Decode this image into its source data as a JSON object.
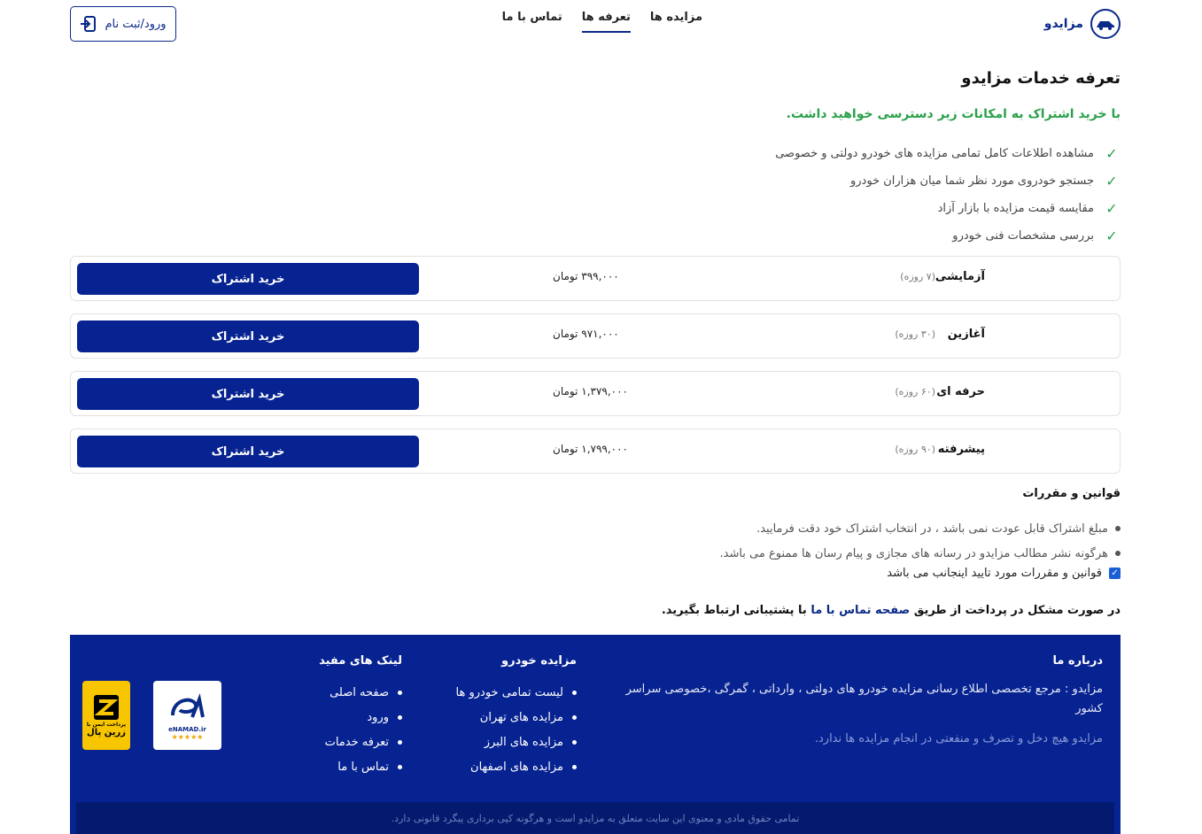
{
  "header": {
    "brand": "مزایدو",
    "nav": [
      "مزایده ها",
      "تعرفه ها",
      "تماس با ما"
    ],
    "login_label": "ورود/ثبت نام"
  },
  "page": {
    "title": "تعرفه خدمات مزایدو",
    "subtitle": "با خرید اشتراک به امکانات زیر دسترسی خواهید داشت.",
    "features": [
      "مشاهده اطلاعات کامل تمامی مزایده های خودرو دولتی و خصوصی",
      "جستجو خودروی مورد نظر شما میان هزاران خودرو",
      "مقایسه قیمت مزایده با بازار آزاد",
      "بررسی مشخصات فنی خودرو"
    ]
  },
  "plans": [
    {
      "name": "آزمایشی",
      "duration": "(۷ روزه)",
      "price": "۳۹۹,۰۰۰ تومان",
      "button": "خرید اشتراک"
    },
    {
      "name": "آغازین",
      "duration": "(۳۰ روزه)",
      "price": "۹۷۱,۰۰۰ تومان",
      "button": "خرید اشتراک"
    },
    {
      "name": "حرفه ای",
      "duration": "(۶۰ روزه)",
      "price": "۱,۳۷۹,۰۰۰ تومان",
      "button": "خرید اشتراک"
    },
    {
      "name": "پیشرفته",
      "duration": "(۹۰ روزه)",
      "price": "۱,۷۹۹,۰۰۰ تومان",
      "button": "خرید اشتراک"
    }
  ],
  "rules": {
    "title": "قوانین و مقررات",
    "items": [
      "مبلغ اشتراک قابل عودت نمی باشد ، در انتخاب اشتراک خود دقت فرمایید.",
      "هرگونه نشر مطالب مزایدو در رسانه های مجازی و پیام رسان ها ممنوع می باشد."
    ],
    "accept_label": "قوانین و مقررات مورد تایید اینجانب می باشد",
    "accepted": true
  },
  "support": {
    "before": "در صورت مشکل در پرداخت از طریق",
    "link": "صفحه تماس با ما",
    "after": "با پشتیبانی ارتباط بگیرید."
  },
  "footer": {
    "about_title": "درباره ما",
    "about_text": "مزایدو : مرجع تخصصی اطلاع رسانی مزایده خودرو های دولتی ، وارداتی ، گمرگی ،خصوصی سراسر کشور",
    "about_note": "مزایدو هیچ دخل و تصرف و منفعتی در انجام مزایده ها ندارد.",
    "cars_title": "مزایده خودرو",
    "cars_links": [
      "لیست تمامی خودرو ها",
      "مزایده های تهران",
      "مزایده های البرز",
      "مزایده های اصفهان"
    ],
    "links_title": "لینک های مفید",
    "links": [
      "صفحه اصلی",
      "ورود",
      "تعرفه خدمات",
      "تماس با ما"
    ],
    "enamad_label": "eNAMAD.ir",
    "zarinpal_line1": "پرداخت ایمن با",
    "zarinpal_line2": "زرین پال",
    "copyright": "تمامی حقوق مادی و معنوی این سایت متعلق به مزایدو است و هرگونه کپی برداری پیگرد قانونی دارد."
  }
}
